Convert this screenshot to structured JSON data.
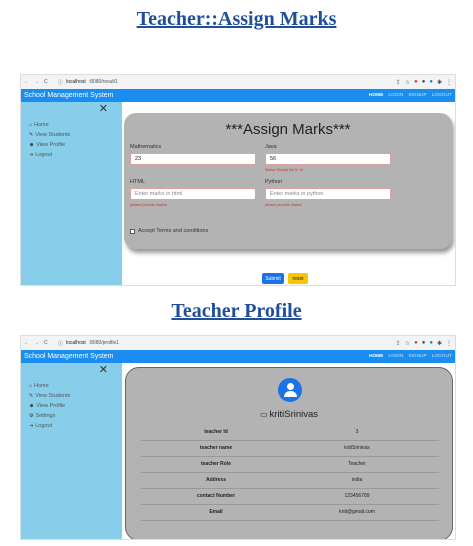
{
  "headings": {
    "assign_marks": "Teacher::Assign Marks",
    "teacher_profile": "Teacher Profile"
  },
  "browser": {
    "nav_icons": [
      "arrow-left-icon",
      "arrow-right-icon",
      "reload-icon"
    ],
    "info_icon": "info-icon",
    "tab1_host": "localhost",
    "tab1_path": ":8080/result1",
    "tab2_host": "localhost",
    "tab2_path": ":8080/profile1"
  },
  "app": {
    "brand": "School Management System",
    "menu": [
      "HOME",
      "LOGIN",
      "SIGNUP",
      "LOGOUT"
    ],
    "close_glyph": "✕",
    "sidebar": [
      {
        "label": "Home",
        "icon": "home-icon"
      },
      {
        "label": "View Students",
        "icon": "pencil-icon"
      },
      {
        "label": "View Profile",
        "icon": "users-icon"
      },
      {
        "label": "Logout",
        "icon": "logout-icon"
      }
    ],
    "sidebar_profile": [
      {
        "label": "Home",
        "icon": "home-icon"
      },
      {
        "label": "View Students",
        "icon": "pencil-icon"
      },
      {
        "label": "View Profile",
        "icon": "users-icon"
      },
      {
        "label": "Settings",
        "icon": "gears-icon"
      },
      {
        "label": "Logout",
        "icon": "logout-icon"
      }
    ]
  },
  "assign_form": {
    "title": "***Assign Marks***",
    "mathematics": {
      "label": "Mathematics",
      "value": "23"
    },
    "java": {
      "label": "Java",
      "value": "56",
      "error": "Marks Should Be In 10"
    },
    "html": {
      "label": "HTML",
      "placeholder": "Enter marks in html",
      "error": "please provide marks!"
    },
    "python": {
      "label": "Python",
      "placeholder": "Enter marks in python",
      "error": "please provide marks!"
    },
    "terms": "Accept Terms and conditions",
    "submit": "Submit",
    "reset": "reset"
  },
  "profile": {
    "username": "kritiSrinivas",
    "rows": [
      {
        "key": "teacher Id",
        "value": "3"
      },
      {
        "key": "teacher name",
        "value": "kritiSrinivas"
      },
      {
        "key": "teacher Role",
        "value": "Teacher"
      },
      {
        "key": "Address",
        "value": "india"
      },
      {
        "key": "contact Number",
        "value": "123456789"
      },
      {
        "key": "Email",
        "value": "kriti@gmail.com"
      }
    ]
  },
  "colors": {
    "heading": "#1f4e9a",
    "appbar": "#1c8df0",
    "sidebar": "#87ceeb",
    "card": "#b3b3b3",
    "submit": "#1a73e8",
    "reset": "#f7c600"
  }
}
